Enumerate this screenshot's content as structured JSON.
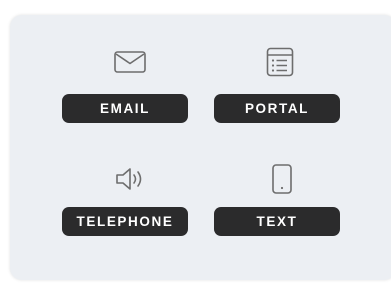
{
  "options": [
    {
      "id": "email",
      "label": "EMAIL",
      "icon": "envelope-icon"
    },
    {
      "id": "portal",
      "label": "PORTAL",
      "icon": "document-list-icon"
    },
    {
      "id": "telephone",
      "label": "TELEPHONE",
      "icon": "speaker-volume-icon"
    },
    {
      "id": "text",
      "label": "TEXT",
      "icon": "smartphone-icon"
    }
  ],
  "colors": {
    "card_background": "#eceff3",
    "pill_background": "#2b2b2c",
    "pill_text": "#ffffff",
    "icon_stroke": "#6d6d6d"
  }
}
